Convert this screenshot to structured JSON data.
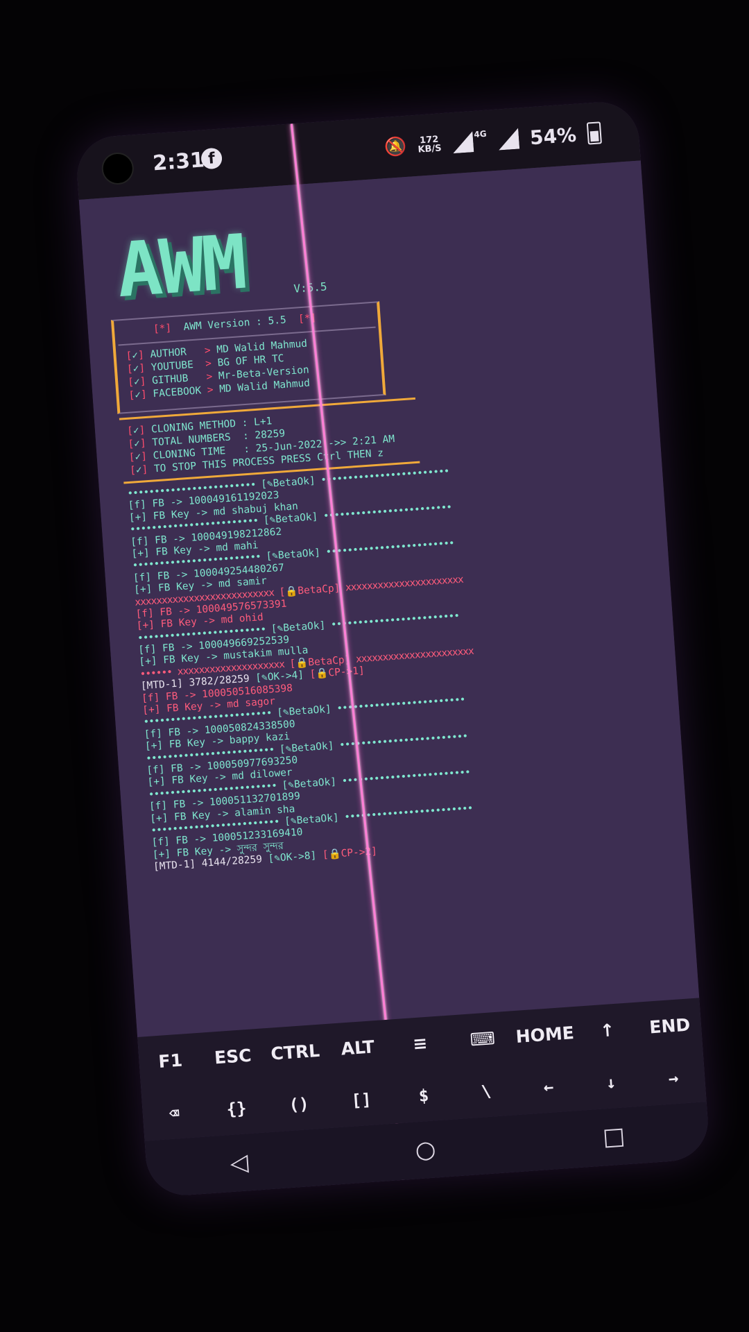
{
  "status_bar": {
    "time": "2:31",
    "app_icon": "facebook-icon",
    "net_speed": "172\nKB/S",
    "network_type": "4G",
    "battery": "54%"
  },
  "header": {
    "logo_text": "AWM",
    "version_tag": "V:5.5",
    "version_line": "AWM Version : 5.5",
    "author_rows": [
      {
        "label": "AUTHOR  ",
        "value": "MD Walid Mahmud"
      },
      {
        "label": "YOUTUBE ",
        "value": "BG OF HR TC"
      },
      {
        "label": "GITHUB  ",
        "value": "Mr-Beta-Version"
      },
      {
        "label": "FACEBOOK",
        "value": "MD Walid Mahmud"
      }
    ]
  },
  "clone_info": [
    "CLONING METHOD : L+1",
    "TOTAL NUMBERS  : 28259",
    "CLONING TIME   : 25-Jun-2022 ->> 2:21 AM",
    "TO STOP THIS PROCESS PRESS Ctrl THEN z"
  ],
  "log": [
    {
      "type": "ok-sep",
      "text": "[✎BetaOk]"
    },
    {
      "type": "ok-fb",
      "text": "[f] FB -> 100049161192023"
    },
    {
      "type": "ok-key",
      "text": "[+] FB Key -> md shabuj khan"
    },
    {
      "type": "ok-sep",
      "text": "[✎BetaOk]"
    },
    {
      "type": "ok-fb",
      "text": "[f] FB -> 100049198212862"
    },
    {
      "type": "ok-key",
      "text": "[+] FB Key -> md mahi"
    },
    {
      "type": "ok-sep",
      "text": "[✎BetaOk]"
    },
    {
      "type": "ok-fb",
      "text": "[f] FB -> 100049254480267"
    },
    {
      "type": "ok-key",
      "text": "[+] FB Key -> md samir"
    },
    {
      "type": "cp-sep",
      "text": "[🔒BetaCp]"
    },
    {
      "type": "cp-fb",
      "text": "[f] FB -> 100049576573391"
    },
    {
      "type": "cp-key",
      "text": "[+] FB Key -> md ohid"
    },
    {
      "type": "ok-sep",
      "text": "[✎BetaOk]"
    },
    {
      "type": "ok-fb",
      "text": "[f] FB -> 100049669252539"
    },
    {
      "type": "ok-key",
      "text": "[+] FB Key -> mustakim mulla"
    },
    {
      "type": "cp-sep-inline",
      "text": "[🔒BetaCp]"
    },
    {
      "type": "mtd",
      "label": "[MTD-1] 3782/28259",
      "ok": "[✎OK->4]",
      "cp": "[🔒CP->1]"
    },
    {
      "type": "cp-fb",
      "text": "[f] FB -> 100050516085398"
    },
    {
      "type": "cp-key",
      "text": "[+] FB Key -> md sagor"
    },
    {
      "type": "ok-sep",
      "text": "[✎BetaOk]"
    },
    {
      "type": "ok-fb",
      "text": "[f] FB -> 100050824338500"
    },
    {
      "type": "ok-key",
      "text": "[+] FB Key -> bappy kazi"
    },
    {
      "type": "ok-sep",
      "text": "[✎BetaOk]"
    },
    {
      "type": "ok-fb",
      "text": "[f] FB -> 100050977693250"
    },
    {
      "type": "ok-key",
      "text": "[+] FB Key -> md dilower"
    },
    {
      "type": "ok-sep",
      "text": "[✎BetaOk]"
    },
    {
      "type": "ok-fb",
      "text": "[f] FB -> 100051132701899"
    },
    {
      "type": "ok-key",
      "text": "[+] FB Key -> alamin sha"
    },
    {
      "type": "ok-sep",
      "text": "[✎BetaOk]"
    },
    {
      "type": "ok-fb",
      "text": "[f] FB -> 100051233169410"
    },
    {
      "type": "ok-key",
      "text": "[+] FB Key -> সুন্দর সুন্দর"
    },
    {
      "type": "mtd",
      "label": "[MTD-1] 4144/28259",
      "ok": "[✎OK->8]",
      "cp": "[🔒CP->2]"
    }
  ],
  "extra_keys": {
    "row1": [
      "F1",
      "ESC",
      "CTRL",
      "ALT",
      "≡",
      "⌨",
      "HOME",
      "↑",
      "END"
    ],
    "row2": [
      "⌫",
      "{}",
      "()",
      "[]",
      "$",
      "\\",
      "←",
      "↓",
      "→"
    ]
  },
  "nav_bar": {
    "back": "◁",
    "home": "○",
    "recents": "□"
  }
}
